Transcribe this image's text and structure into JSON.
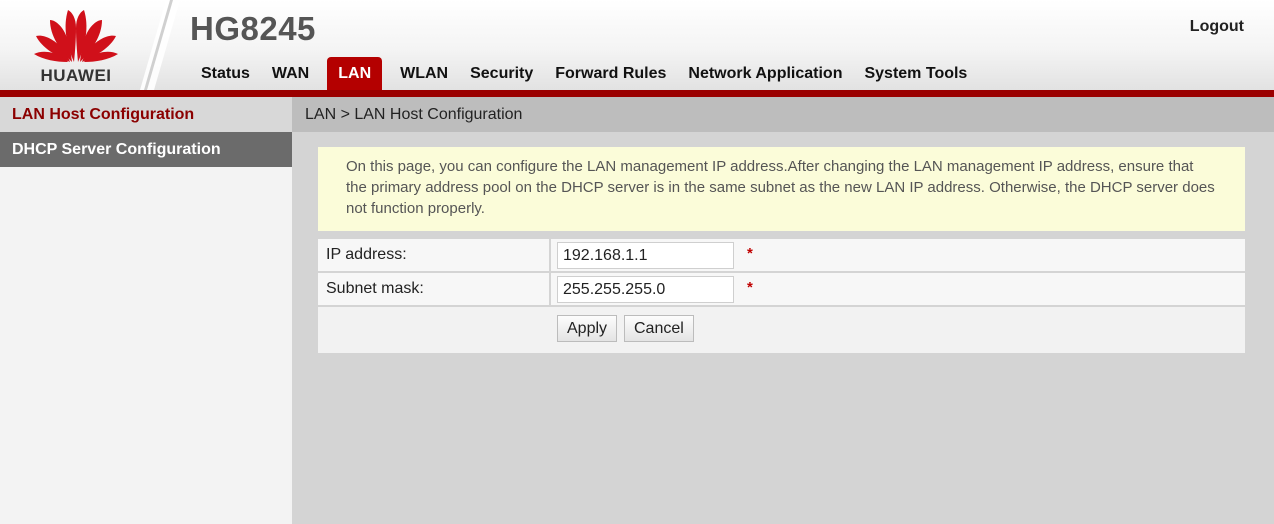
{
  "brand": {
    "logo_text": "HUAWEI",
    "model": "HG8245",
    "accent_color": "#b40000"
  },
  "header": {
    "logout_label": "Logout"
  },
  "nav": [
    {
      "label": "Status",
      "active": false
    },
    {
      "label": "WAN",
      "active": false
    },
    {
      "label": "LAN",
      "active": true
    },
    {
      "label": "WLAN",
      "active": false
    },
    {
      "label": "Security",
      "active": false
    },
    {
      "label": "Forward Rules",
      "active": false
    },
    {
      "label": "Network Application",
      "active": false
    },
    {
      "label": "System Tools",
      "active": false
    }
  ],
  "sidebar": {
    "items": [
      {
        "label": "LAN Host Configuration",
        "state": "active"
      },
      {
        "label": "DHCP Server Configuration",
        "state": "highlight"
      }
    ]
  },
  "main": {
    "breadcrumb": "LAN > LAN Host Configuration",
    "info": "On this page, you can configure the LAN management IP address.After changing the LAN management IP address, ensure that the primary address pool on the DHCP server is in the same subnet as the new LAN IP address. Otherwise, the DHCP server does not function properly.",
    "form": {
      "ip_label": "IP address:",
      "ip_value": "192.168.1.1",
      "mask_label": "Subnet mask:",
      "mask_value": "255.255.255.0",
      "required_mark": "*"
    },
    "buttons": {
      "apply": "Apply",
      "cancel": "Cancel"
    }
  },
  "icons": {
    "logo": "huawei-petal-logo"
  }
}
